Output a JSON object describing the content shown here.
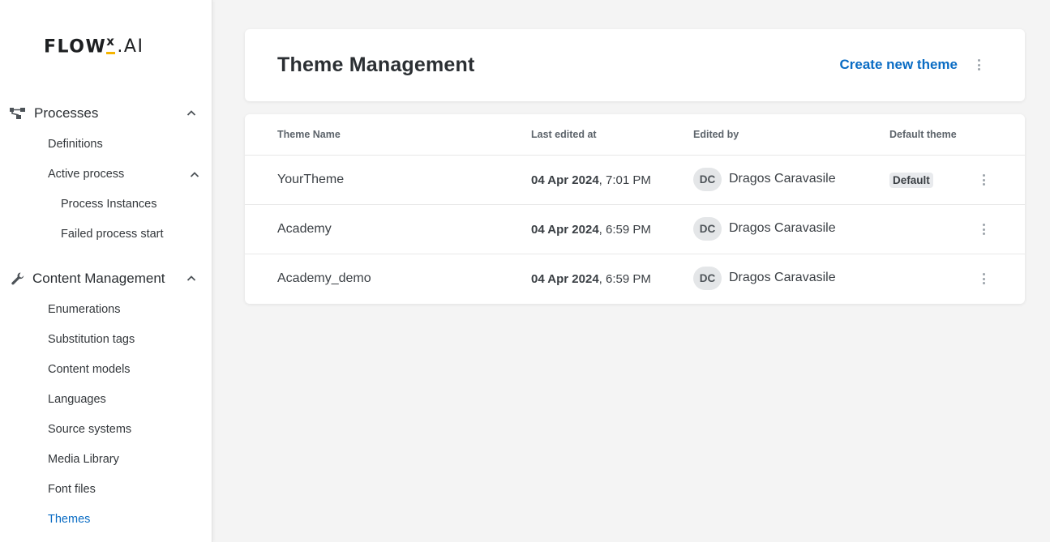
{
  "app": {
    "logo_main": "FLOW",
    "logo_x": "x",
    "logo_suffix": ".AI"
  },
  "sidebar": {
    "sections": [
      {
        "label": "Processes",
        "icon": "process-flow-icon"
      },
      {
        "label": "Content Management",
        "icon": "wrench-icon"
      }
    ],
    "process_items": [
      {
        "label": "Definitions"
      },
      {
        "label": "Active process"
      }
    ],
    "active_process_items": [
      {
        "label": "Process Instances"
      },
      {
        "label": "Failed process start"
      }
    ],
    "content_items": [
      {
        "label": "Enumerations"
      },
      {
        "label": "Substitution tags"
      },
      {
        "label": "Content models"
      },
      {
        "label": "Languages"
      },
      {
        "label": "Source systems"
      },
      {
        "label": "Media Library"
      },
      {
        "label": "Font files"
      },
      {
        "label": "Themes"
      }
    ],
    "active_item": "Themes"
  },
  "header": {
    "title": "Theme Management",
    "create_label": "Create new theme"
  },
  "table": {
    "columns": [
      "Theme Name",
      "Last edited at",
      "Edited by",
      "Default theme"
    ],
    "rows": [
      {
        "name": "YourTheme",
        "date": "04 Apr 2024",
        "time": ", 7:01 PM",
        "initials": "DC",
        "user": "Dragos Caravasile",
        "default": "Default"
      },
      {
        "name": "Academy",
        "date": "04 Apr 2024",
        "time": ", 6:59 PM",
        "initials": "DC",
        "user": "Dragos Caravasile",
        "default": ""
      },
      {
        "name": "Academy_demo",
        "date": "04 Apr 2024",
        "time": ", 6:59 PM",
        "initials": "DC",
        "user": "Dragos Caravasile",
        "default": ""
      }
    ]
  },
  "colors": {
    "accent": "#0a6cc4",
    "logo_accent": "#f5b400"
  }
}
